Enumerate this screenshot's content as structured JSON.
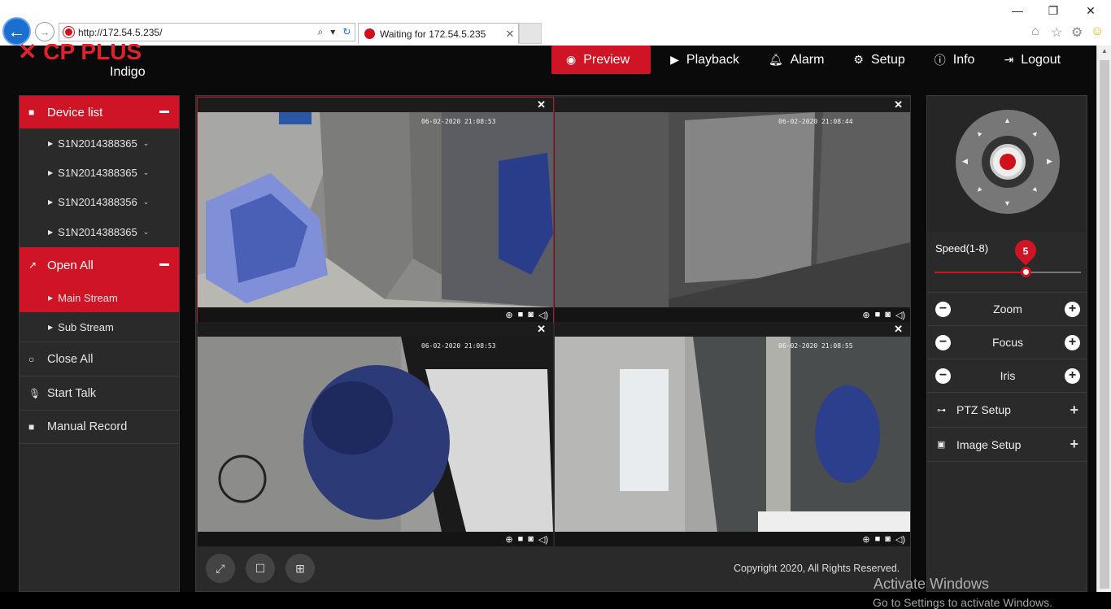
{
  "browser": {
    "url": "http://172.54.5.235/",
    "tab_title": "Waiting for 172.54.5.235",
    "tab_close": "✕",
    "back": "←",
    "forward": "→",
    "minimize": "—",
    "restore": "❐",
    "close": "✕"
  },
  "app": {
    "logo": "CP PLUS",
    "logo_sub": "Indigo"
  },
  "topnav": [
    {
      "label": "Preview",
      "icon": "eye-icon",
      "active": true
    },
    {
      "label": "Playback",
      "icon": "play-circle-icon"
    },
    {
      "label": "Alarm",
      "icon": "bell-icon"
    },
    {
      "label": "Setup",
      "icon": "gear-icon"
    },
    {
      "label": "Info",
      "icon": "info-icon"
    },
    {
      "label": "Logout",
      "icon": "logout-icon"
    }
  ],
  "sidebar": {
    "device_list": "Device list",
    "devices": [
      "S1N2014388365",
      "S1N2014388365",
      "S1N2014388356",
      "S1N2014388365"
    ],
    "open_all": "Open All",
    "main_stream": "Main Stream",
    "sub_stream": "Sub Stream",
    "close_all": "Close All",
    "start_talk": "Start Talk",
    "manual_record": "Manual Record"
  },
  "cameras": [
    {
      "timestamp": "06-02-2020 21:08:53",
      "selected": true
    },
    {
      "timestamp": "06-02-2020 21:08:44",
      "selected": false
    },
    {
      "timestamp": "06-02-2020 21:08:53",
      "selected": false
    },
    {
      "timestamp": "06-02-2020 21:08:55",
      "selected": false
    }
  ],
  "footer": {
    "copyright": "Copyright 2020, All Rights Reserved."
  },
  "ptz": {
    "speed_label": "Speed(1-8)",
    "speed_value": "5",
    "speed_level": 5,
    "speed_max": 8,
    "zoom": "Zoom",
    "focus": "Focus",
    "iris": "Iris",
    "ptz_setup": "PTZ Setup",
    "image_setup": "Image Setup"
  },
  "watermark": {
    "line1": "Activate Windows",
    "line2": "Go to Settings to activate Windows."
  },
  "colors": {
    "accent": "#cf1425",
    "panel": "#2a2a2a"
  }
}
